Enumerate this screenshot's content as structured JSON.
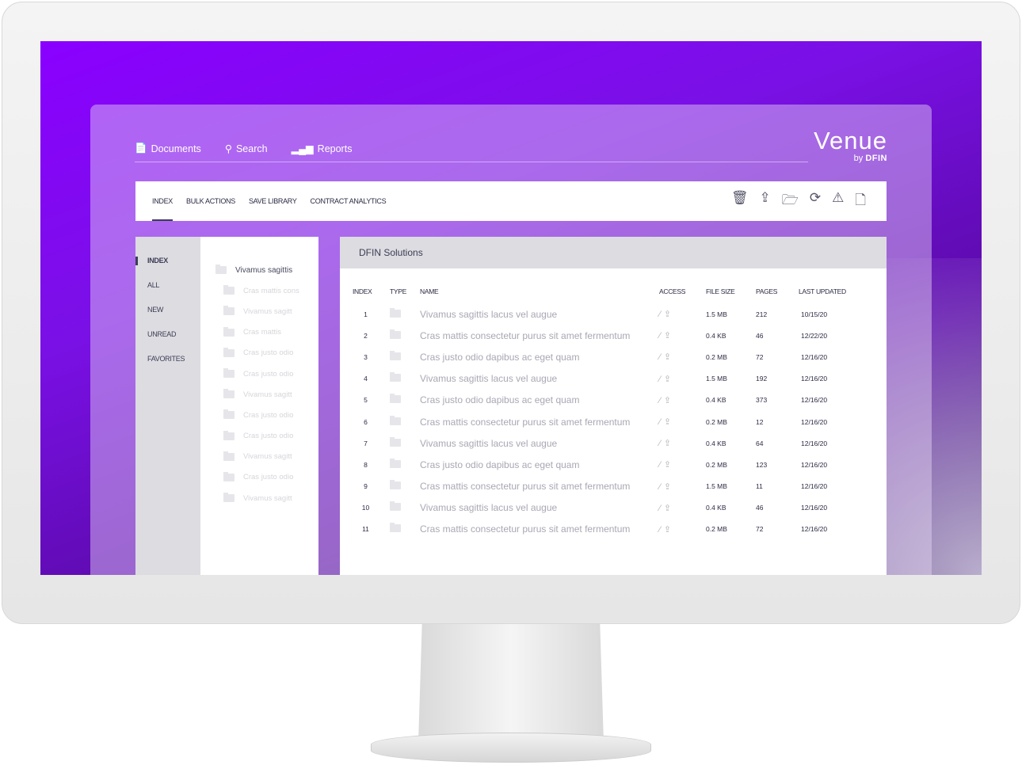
{
  "nav": {
    "items": [
      {
        "label": "Documents",
        "icon": "documents-icon"
      },
      {
        "label": "Search",
        "icon": "search-icon"
      },
      {
        "label": "Reports",
        "icon": "bar-chart-icon"
      }
    ]
  },
  "logo": {
    "name": "Venue",
    "by": "by",
    "brand": "DFIN"
  },
  "toolbar": {
    "tabs": [
      "INDEX",
      "BULK ACTIONS",
      "SAVE LIBRARY",
      "CONTRACT ANALYTICS"
    ],
    "active": "INDEX",
    "tools": [
      "trash-icon",
      "upload-icon",
      "folder-add-icon",
      "refresh-icon",
      "warning-icon",
      "document-icon"
    ]
  },
  "sidebar": {
    "items": [
      "INDEX",
      "ALL",
      "NEW",
      "UNREAD",
      "FAVORITES"
    ],
    "active": "INDEX"
  },
  "tree": {
    "root": "Vivamus sagittis",
    "children": [
      "Cras mattis cons",
      "Vivamus sagitt",
      "Cras mattis",
      "Cras justo odio",
      "Cras justo odio",
      "Vivamus sagitt",
      "Cras justo odio",
      "Cras justo odio",
      "Vivamus sagitt",
      "Cras justo odio",
      "Vivamus sagitt"
    ]
  },
  "main": {
    "title": "DFIN Solutions",
    "columns": [
      "INDEX",
      "TYPE",
      "NAME",
      "ACCESS",
      "FILE SIZE",
      "PAGES",
      "LAST UPDATED"
    ],
    "rows": [
      [
        "1",
        "Vivamus sagittis lacus vel augue",
        "1.5 MB",
        "212",
        "10/15/20"
      ],
      [
        "2",
        "Cras mattis consectetur purus sit amet fermentum",
        "0.4 KB",
        "46",
        "12/22/20"
      ],
      [
        "3",
        "Cras justo odio dapibus ac eget quam",
        "0.2 MB",
        "72",
        "12/16/20"
      ],
      [
        "4",
        "Vivamus sagittis lacus vel augue",
        "1.5 MB",
        "192",
        "12/16/20"
      ],
      [
        "5",
        "Cras justo odio dapibus ac eget quam",
        "0.4 KB",
        "373",
        "12/16/20"
      ],
      [
        "6",
        "Cras mattis consectetur purus sit amet fermentum",
        "0.2 MB",
        "12",
        "12/16/20"
      ],
      [
        "7",
        "Vivamus sagittis lacus vel augue",
        "0.4 KB",
        "64",
        "12/16/20"
      ],
      [
        "8",
        "Cras justo odio dapibus ac eget quam",
        "0.2 MB",
        "123",
        "12/16/20"
      ],
      [
        "9",
        "Cras mattis consectetur purus sit amet fermentum",
        "1.5 MB",
        "11",
        "12/16/20"
      ],
      [
        "10",
        "Vivamus sagittis lacus vel augue",
        "0.4 KB",
        "46",
        "12/16/20"
      ],
      [
        "11",
        "Cras mattis consectetur purus sit amet fermentum",
        "0.2 MB",
        "72",
        "12/16/20"
      ]
    ]
  }
}
